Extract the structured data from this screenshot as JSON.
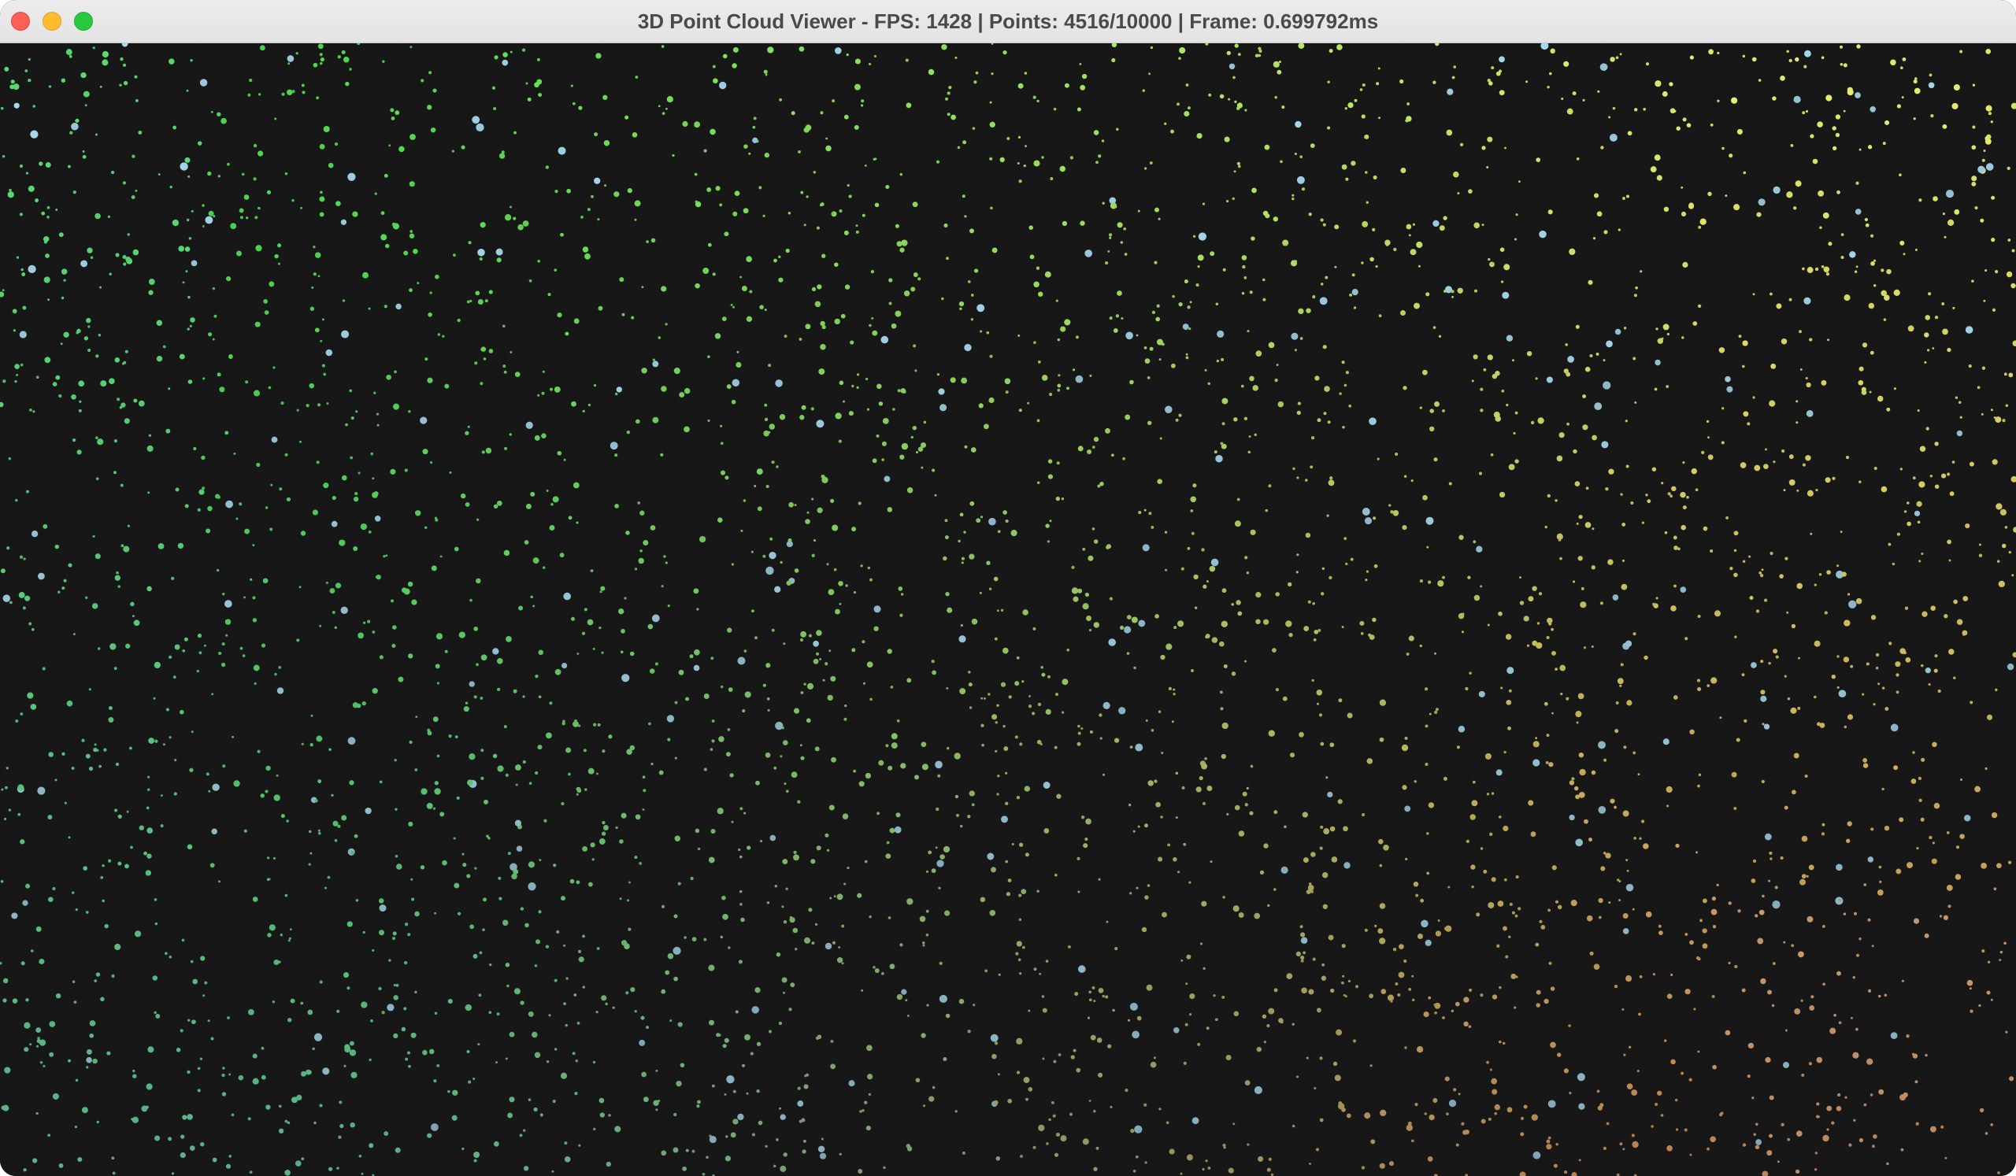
{
  "window": {
    "title": "3D Point Cloud Viewer - FPS: 1428 | Points: 4516/10000 | Frame: 0.699792ms",
    "buttons": {
      "close": "close-button",
      "minimize": "minimize-button",
      "zoom": "zoom-button"
    }
  },
  "colors": {
    "background": "#171717",
    "titlebar": "#e6e6e6",
    "title_text": "#4a4a4a",
    "close": "#fe5f57",
    "minimize": "#febc2e",
    "zoom": "#28c840",
    "point_green": "#4ee04e",
    "point_cyan": "#6ee0c0",
    "point_yellow": "#e8f070",
    "point_orange": "#f0a060",
    "point_lightblue": "#a8dcf0"
  },
  "point_cloud": {
    "rendered_points": 4516,
    "total_points": 10000,
    "fps": 1428,
    "frame_time_ms": 0.699792
  }
}
